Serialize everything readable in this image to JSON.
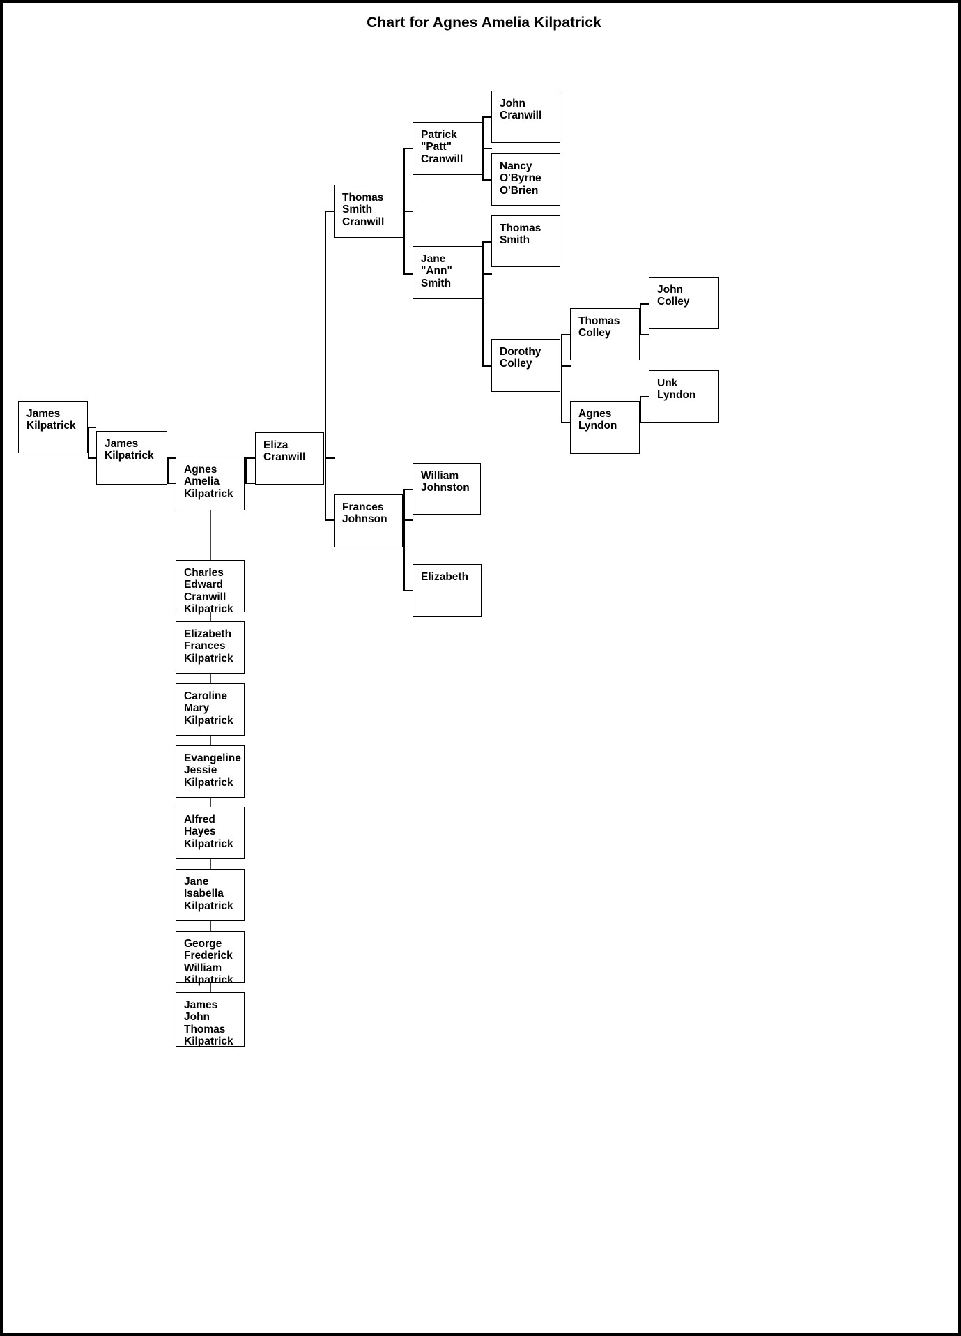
{
  "page": {
    "title": "Chart for Agnes Amelia Kilpatrick",
    "background_color": "#ffffff",
    "border_color": "#000000",
    "text_color": "#000000"
  },
  "chart_data": {
    "type": "diagram",
    "diagram_kind": "genealogy-pedigree-chart",
    "title": "Chart for Agnes Amelia Kilpatrick",
    "root_person": "Agnes Amelia Kilpatrick",
    "nodes": {
      "james_kilpatrick_gf": "James\nKilpatrick",
      "james_kilpatrick_f": "James\nKilpatrick",
      "agnes_amelia_kilpatrick": "Agnes\nAmelia\nKilpatrick",
      "eliza_cranwill": "Eliza\nCranwill",
      "thomas_smith_cranwill": "Thomas\nSmith\nCranwill",
      "frances_johnson": "Frances\nJohnson",
      "patrick_patt_cranwill": "Patrick\n\"Patt\"\nCranwill",
      "jane_ann_smith": "Jane \"Ann\"\nSmith",
      "john_cranwill": "John\nCranwill",
      "nancy_obyrne_obrien": "Nancy\nO'Byrne\nO'Brien",
      "thomas_smith": "Thomas\nSmith",
      "dorothy_colley": "Dorothy\nColley",
      "thomas_colley": "Thomas\nColley",
      "agnes_lyndon": "Agnes\nLyndon",
      "john_colley": "John Colley",
      "unk_lyndon": "Unk Lyndon",
      "william_johnston": "William\nJohnston",
      "elizabeth": "Elizabeth",
      "child_1": "Charles\nEdward\nCranwill\nKilpatrick",
      "child_2": "Elizabeth\nFrances\nKilpatrick",
      "child_3": "Caroline\nMary\nKilpatrick",
      "child_4": "Evangeline\nJessie\nKilpatrick",
      "child_5": "Alfred\nHayes\nKilpatrick",
      "child_6": "Jane\nIsabella\nKilpatrick",
      "child_7": "George\nFrederick\nWilliam\nKilpatrick",
      "child_8": "James John\nThomas\nKilpatrick"
    }
  }
}
